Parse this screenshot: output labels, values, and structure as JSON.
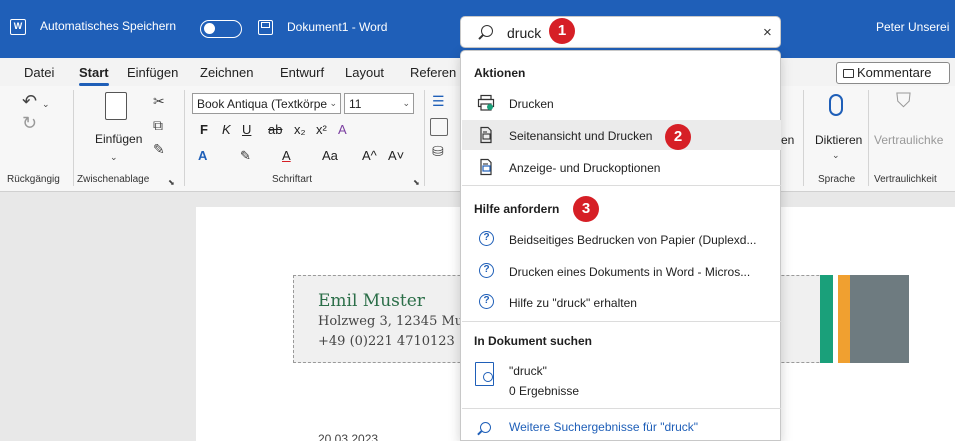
{
  "titlebar": {
    "logo": "W",
    "autosave_label": "Automatisches Speichern",
    "doc_name": "Dokument1  -  Word",
    "user_name": "Peter Unserei"
  },
  "tabs": [
    "Datei",
    "Start",
    "Einfügen",
    "Zeichnen",
    "Entwurf",
    "Layout",
    "Referen"
  ],
  "active_tab": "Start",
  "comments_label": "Kommentare",
  "ribbon": {
    "undo_group": "Rückgängig",
    "clipboard_group": "Zwischenablage",
    "paste_label": "Einfügen",
    "font_group": "Schriftart",
    "font_name": "Book Antiqua (Textkörpe",
    "font_size": "11",
    "dictate_label": "Diktieren",
    "speech_group": "Sprache",
    "sensitivity_label": "Vertraulichke",
    "sensitivity_group": "Vertraulichkeit",
    "partial_label": "en"
  },
  "search": {
    "query": "druck",
    "clear_icon": "close-icon"
  },
  "panel": {
    "actions_title": "Aktionen",
    "actions": [
      {
        "label": "Drucken",
        "icon": "printer-icon"
      },
      {
        "label": "Seitenansicht und Drucken",
        "icon": "print-preview-icon"
      },
      {
        "label": "Anzeige- und Druckoptionen",
        "icon": "print-options-icon"
      }
    ],
    "help_title": "Hilfe anfordern",
    "help": [
      {
        "label": "Beidseitiges Bedrucken von Papier (Duplexd...",
        "icon": "help-icon"
      },
      {
        "label": "Drucken eines Dokuments in Word - Micros...",
        "icon": "help-icon"
      },
      {
        "label": "Hilfe zu \"druck\" erhalten",
        "icon": "help-icon"
      }
    ],
    "doc_search_title": "In Dokument suchen",
    "doc_result_term": "\"druck\"",
    "doc_result_count": "0 Ergebnisse",
    "more_results": "Weitere Suchergebnisse für \"druck\""
  },
  "document": {
    "name": "Emil Muster",
    "address": "Holzweg 3, 12345 Mu",
    "phone": "+49 (0)221 4710123",
    "date": "20.03.2023"
  },
  "callouts": [
    "1",
    "2",
    "3"
  ],
  "colors": {
    "title_blue": "#1f5fb8",
    "callout_red": "#d61f26",
    "stripe_green": "#1aa07a",
    "stripe_orange": "#f0a030",
    "stripe_gray": "#6e7b80",
    "name_green": "#2b6e48"
  }
}
